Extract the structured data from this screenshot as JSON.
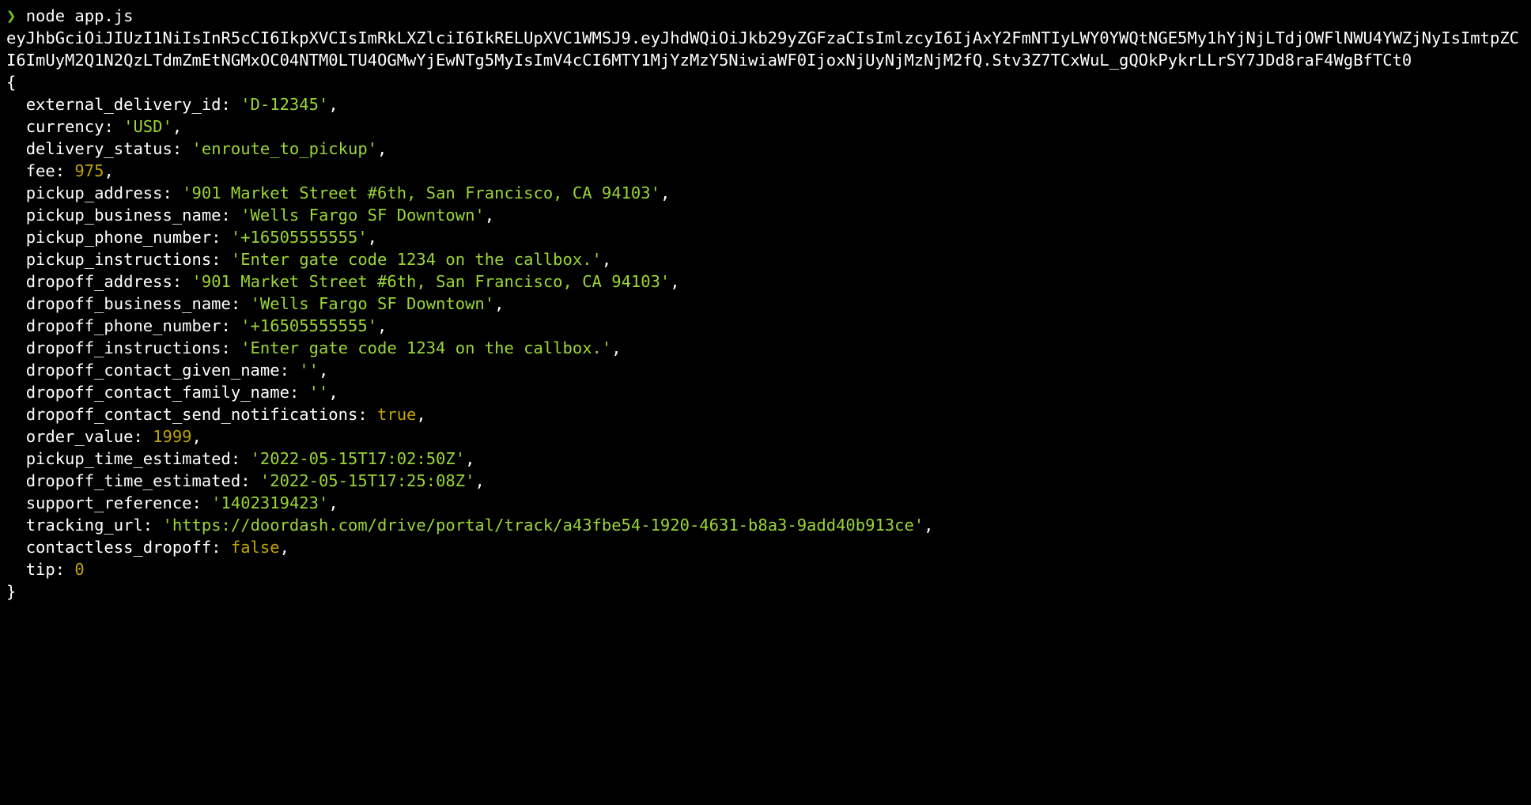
{
  "prompt_symbol": "❯",
  "command": "node app.js",
  "jwt": "eyJhbGciOiJIUzI1NiIsInR5cCI6IkpXVCIsImRkLXZlciI6IkRELUpXVC1WMSJ9.eyJhdWQiOiJkb29yZGFzaCIsImlzcyI6IjAxY2FmNTIyLWY0YWQtNGE5My1hYjNjLTdjOWFlNWU4YWZjNyIsImtpZCI6ImUyM2Q1N2QzLTdmZmEtNGMxOC04NTM0LTU4OGMwYjEwNTg5MyIsImV4cCI6MTY1MjYzMzY5NiwiaWF0IjoxNjUyNjMzNjM2fQ.Stv3Z7TCxWuL_gQOkPykrLLrSY7JDd8raF4WgBfTCt0",
  "fields": {
    "external_delivery_id": {
      "value": "D-12345",
      "type": "str"
    },
    "currency": {
      "value": "USD",
      "type": "str"
    },
    "delivery_status": {
      "value": "enroute_to_pickup",
      "type": "str"
    },
    "fee": {
      "value": "975",
      "type": "num"
    },
    "pickup_address": {
      "value": "901 Market Street #6th, San Francisco, CA 94103",
      "type": "str"
    },
    "pickup_business_name": {
      "value": "Wells Fargo SF Downtown",
      "type": "str"
    },
    "pickup_phone_number": {
      "value": "+16505555555",
      "type": "str"
    },
    "pickup_instructions": {
      "value": "Enter gate code 1234 on the callbox.",
      "type": "str"
    },
    "dropoff_address": {
      "value": "901 Market Street #6th, San Francisco, CA 94103",
      "type": "str"
    },
    "dropoff_business_name": {
      "value": "Wells Fargo SF Downtown",
      "type": "str"
    },
    "dropoff_phone_number": {
      "value": "+16505555555",
      "type": "str"
    },
    "dropoff_instructions": {
      "value": "Enter gate code 1234 on the callbox.",
      "type": "str"
    },
    "dropoff_contact_given_name": {
      "value": "",
      "type": "str"
    },
    "dropoff_contact_family_name": {
      "value": "",
      "type": "str"
    },
    "dropoff_contact_send_notifications": {
      "value": "true",
      "type": "bool"
    },
    "order_value": {
      "value": "1999",
      "type": "num"
    },
    "pickup_time_estimated": {
      "value": "2022-05-15T17:02:50Z",
      "type": "str"
    },
    "dropoff_time_estimated": {
      "value": "2022-05-15T17:25:08Z",
      "type": "str"
    },
    "support_reference": {
      "value": "1402319423",
      "type": "str"
    },
    "tracking_url": {
      "value": "https://doordash.com/drive/portal/track/a43fbe54-1920-4631-b8a3-9add40b913ce",
      "type": "str"
    },
    "contactless_dropoff": {
      "value": "false",
      "type": "bool"
    },
    "tip": {
      "value": "0",
      "type": "num"
    }
  },
  "field_order": [
    "external_delivery_id",
    "currency",
    "delivery_status",
    "fee",
    "pickup_address",
    "pickup_business_name",
    "pickup_phone_number",
    "pickup_instructions",
    "dropoff_address",
    "dropoff_business_name",
    "dropoff_phone_number",
    "dropoff_instructions",
    "dropoff_contact_given_name",
    "dropoff_contact_family_name",
    "dropoff_contact_send_notifications",
    "order_value",
    "pickup_time_estimated",
    "dropoff_time_estimated",
    "support_reference",
    "tracking_url",
    "contactless_dropoff",
    "tip"
  ]
}
